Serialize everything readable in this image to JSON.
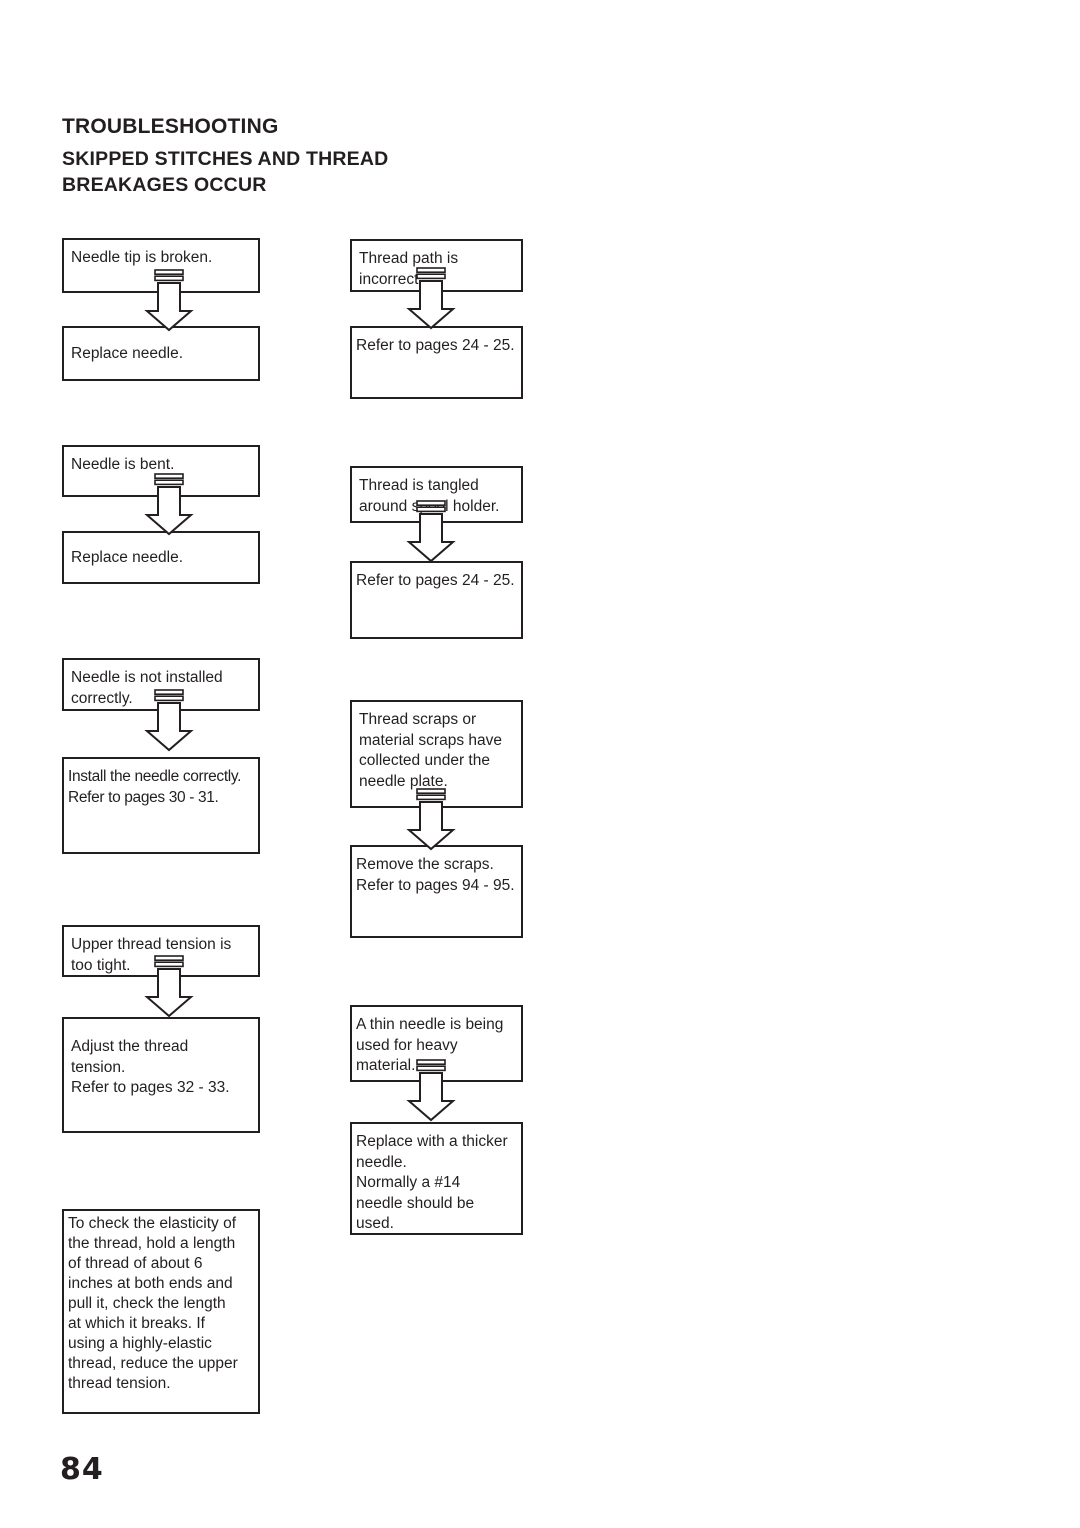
{
  "document": {
    "title": "TROUBLESHOOTING",
    "subtitle_line1": "SKIPPED STITCHES AND THREAD",
    "subtitle_line2": "BREAKAGES OCCUR",
    "page_number": "84"
  },
  "colors": {
    "ink": "#231f20",
    "page_background": "#ffffff",
    "box_border": "#231f20"
  },
  "flow": {
    "column_left": [
      {
        "id": "needle-tip-broken",
        "cause": {
          "lines": [
            "Needle tip is broken."
          ]
        },
        "remedy": {
          "lines": [
            "Replace needle."
          ]
        }
      },
      {
        "id": "needle-bent",
        "cause": {
          "lines": [
            "Needle is bent."
          ]
        },
        "remedy": {
          "lines": [
            "Replace needle."
          ]
        }
      },
      {
        "id": "needle-not-installed-correctly",
        "cause": {
          "lines": [
            "Needle is not installed",
            "correctly."
          ]
        },
        "remedy": {
          "lines": [
            "Install the needle correctly.",
            "Refer to pages 30 - 31."
          ]
        }
      },
      {
        "id": "upper-thread-tension-too-tight",
        "cause": {
          "lines": [
            "Upper thread tension is",
            "too tight."
          ]
        },
        "remedy": {
          "lines": [
            "Adjust the thread",
            "tension.",
            "Refer to pages 32 - 33."
          ]
        }
      }
    ],
    "column_right": [
      {
        "id": "thread-path-incorrect",
        "cause": {
          "lines": [
            "Thread path is",
            "incorrect."
          ]
        },
        "remedy": {
          "lines": [
            "Refer to pages 24 - 25."
          ]
        }
      },
      {
        "id": "thread-tangled-spool-holder",
        "cause": {
          "lines": [
            "Thread is tangled",
            "around spool holder."
          ]
        },
        "remedy": {
          "lines": [
            "Refer to pages 24 - 25."
          ]
        }
      },
      {
        "id": "scraps-under-needle-plate",
        "cause": {
          "lines": [
            "Thread scraps or",
            "material scraps have",
            "collected under the",
            "needle plate."
          ]
        },
        "remedy": {
          "lines": [
            "Remove the scraps.",
            "Refer to pages 94 - 95."
          ]
        }
      },
      {
        "id": "thin-needle-heavy-material",
        "cause": {
          "lines": [
            "A thin needle is being",
            "used for heavy",
            "material."
          ]
        },
        "remedy": {
          "lines": [
            "Replace with a thicker",
            "needle.",
            "Normally a #14",
            "needle should be",
            "used."
          ]
        }
      }
    ],
    "note": {
      "id": "thread-elasticity-note",
      "lines": [
        "To check the elasticity of",
        "the thread, hold a length",
        "of thread of about 6",
        "inches at both ends and",
        "pull it, check the length",
        "at which it breaks. If",
        "using a highly-elastic",
        "thread, reduce the upper",
        "thread tension."
      ]
    }
  },
  "icons": {
    "flow_arrow": "down-arrow-icon"
  }
}
